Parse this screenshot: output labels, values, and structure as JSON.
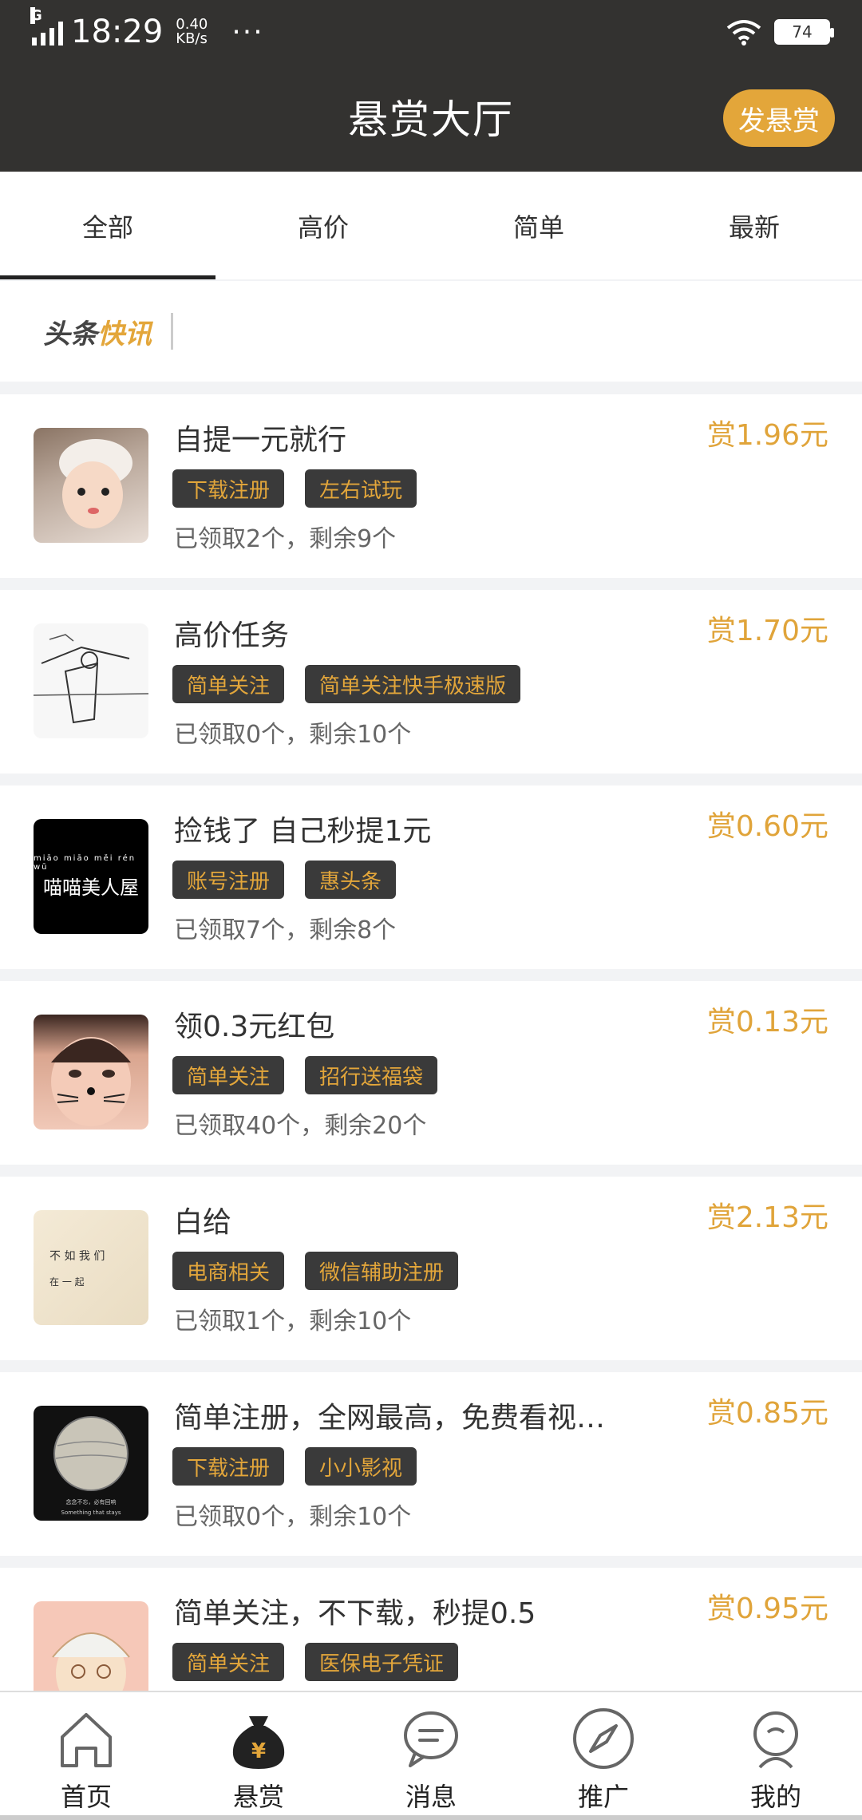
{
  "status_bar": {
    "network": "G",
    "time": "18:29",
    "speed_value": "0.40",
    "speed_unit": "KB/s",
    "dots": "···",
    "battery": "74"
  },
  "header": {
    "title": "悬赏大厅",
    "post_button": "发悬赏"
  },
  "tabs": [
    {
      "label": "全部",
      "active": true
    },
    {
      "label": "高价",
      "active": false
    },
    {
      "label": "简单",
      "active": false
    },
    {
      "label": "最新",
      "active": false
    }
  ],
  "news": {
    "logo_part1": "头条",
    "logo_part2": "快讯"
  },
  "tasks": [
    {
      "title": "自提一元就行",
      "reward": "赏1.96元",
      "tags": [
        "下载注册",
        "左右试玩"
      ],
      "claimed": "已领取2个，",
      "remaining": "剩余9个"
    },
    {
      "title": "高价任务",
      "reward": "赏1.70元",
      "tags": [
        "简单关注",
        "简单关注快手极速版"
      ],
      "claimed": "已领取0个，",
      "remaining": "剩余10个"
    },
    {
      "title": "捡钱了 自己秒提1元",
      "reward": "赏0.60元",
      "tags": [
        "账号注册",
        "惠头条"
      ],
      "claimed": "已领取7个，",
      "remaining": "剩余8个",
      "thumb_text": "喵喵美人屋",
      "thumb_pinyin": "miāo miāo měi rén wū"
    },
    {
      "title": "领0.3元红包",
      "reward": "赏0.13元",
      "tags": [
        "简单关注",
        "招行送福袋"
      ],
      "claimed": "已领取40个，",
      "remaining": "剩余20个"
    },
    {
      "title": "白给",
      "reward": "赏2.13元",
      "tags": [
        "电商相关",
        "微信辅助注册"
      ],
      "claimed": "已领取1个，",
      "remaining": "剩余10个",
      "thumb_line1": "不 如 我 们",
      "thumb_line2": "在 一 起"
    },
    {
      "title": "简单注册，全网最高，免费看视…",
      "reward": "赏0.85元",
      "tags": [
        "下载注册",
        "小小影视"
      ],
      "claimed": "已领取0个，",
      "remaining": "剩余10个",
      "thumb_line1": "念念不忘，必有回响",
      "thumb_line2": "Something that stays"
    },
    {
      "title": "简单关注，不下载，秒提0.5",
      "reward": "赏0.95元",
      "tags": [
        "简单关注",
        "医保电子凭证"
      ],
      "claimed": "",
      "remaining": ""
    }
  ],
  "bottom_nav": [
    {
      "label": "首页",
      "icon": "home-icon"
    },
    {
      "label": "悬赏",
      "icon": "money-bag-icon"
    },
    {
      "label": "消息",
      "icon": "message-icon"
    },
    {
      "label": "推广",
      "icon": "compass-icon"
    },
    {
      "label": "我的",
      "icon": "profile-icon"
    }
  ],
  "colors": {
    "header_bg": "#333230",
    "accent": "#e3a63a",
    "tag_bg": "#3a3a3a"
  }
}
